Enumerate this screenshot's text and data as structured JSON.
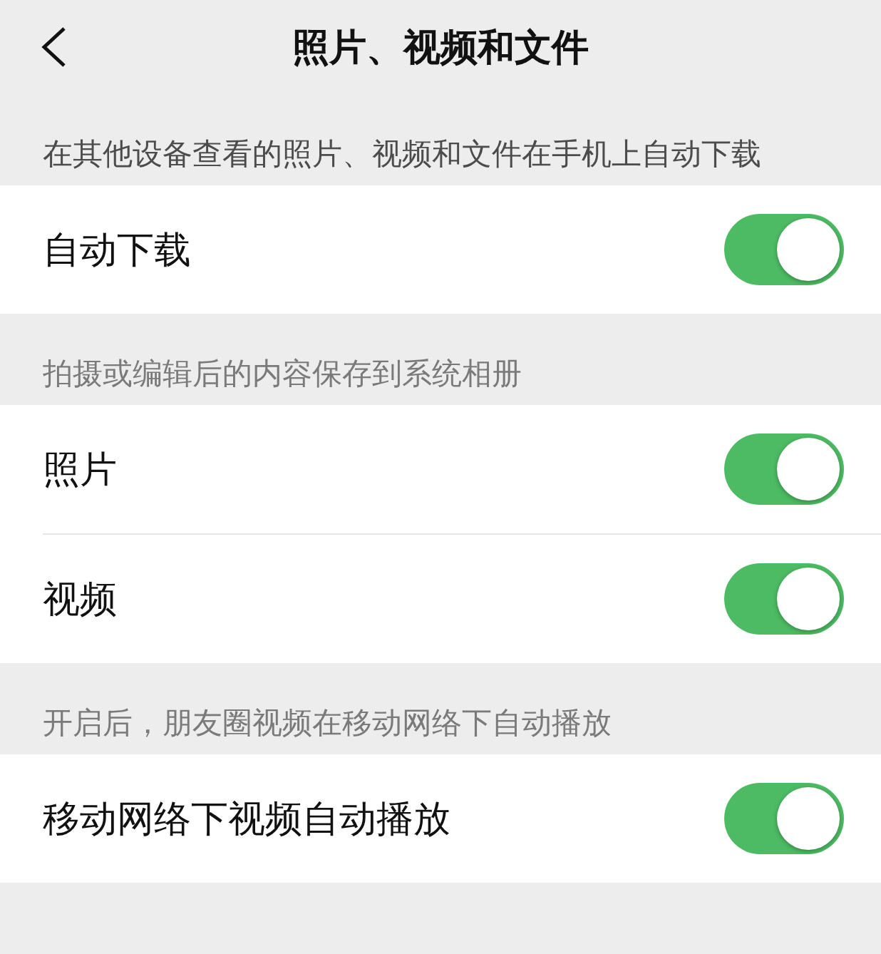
{
  "header": {
    "title": "照片、视频和文件"
  },
  "sections": [
    {
      "note": "在其他设备查看的照片、视频和文件在手机上自动下载",
      "rows": [
        {
          "label": "自动下载",
          "on": true
        }
      ]
    },
    {
      "note": "拍摄或编辑后的内容保存到系统相册",
      "rows": [
        {
          "label": "照片",
          "on": true
        },
        {
          "label": "视频",
          "on": true
        }
      ]
    },
    {
      "note": "开启后，朋友圈视频在移动网络下自动播放",
      "rows": [
        {
          "label": "移动网络下视频自动播放",
          "on": true
        }
      ]
    }
  ]
}
